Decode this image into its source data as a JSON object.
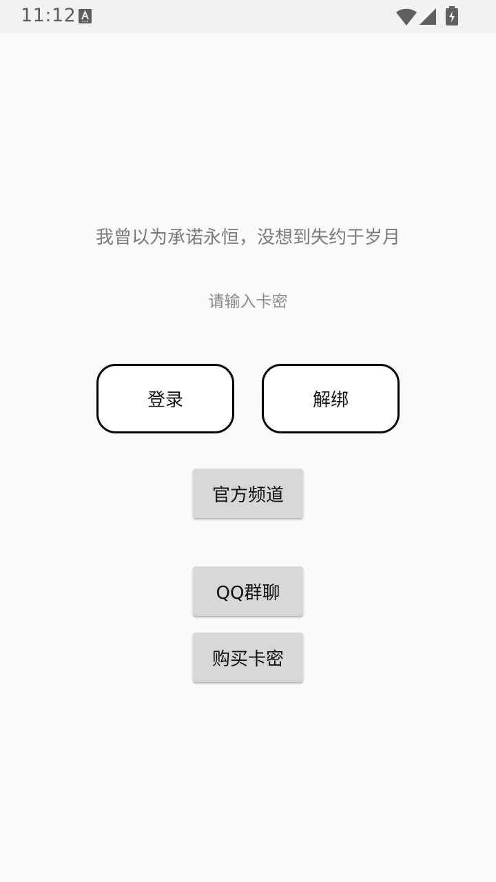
{
  "status_bar": {
    "time": "11:12",
    "icons": [
      "text-a-icon",
      "wifi-icon",
      "signal-icon",
      "battery-charging-icon"
    ],
    "icon_color": "#5f5f5f"
  },
  "main": {
    "slogan": "我曾以为承诺永恒，没想到失约于岁月",
    "card_input": {
      "value": "",
      "placeholder": "请输入卡密"
    },
    "login_label": "登录",
    "unbind_label": "解绑",
    "official_channel_label": "官方频道",
    "qq_group_label": "QQ群聊",
    "buy_card_label": "购买卡密"
  },
  "colors": {
    "background": "#fafafa",
    "status_bar_bg": "#f2f2f2",
    "flat_button_bg": "#d6d7d7",
    "outline_button_border": "#000000",
    "slogan_text": "#7a7a7a"
  }
}
